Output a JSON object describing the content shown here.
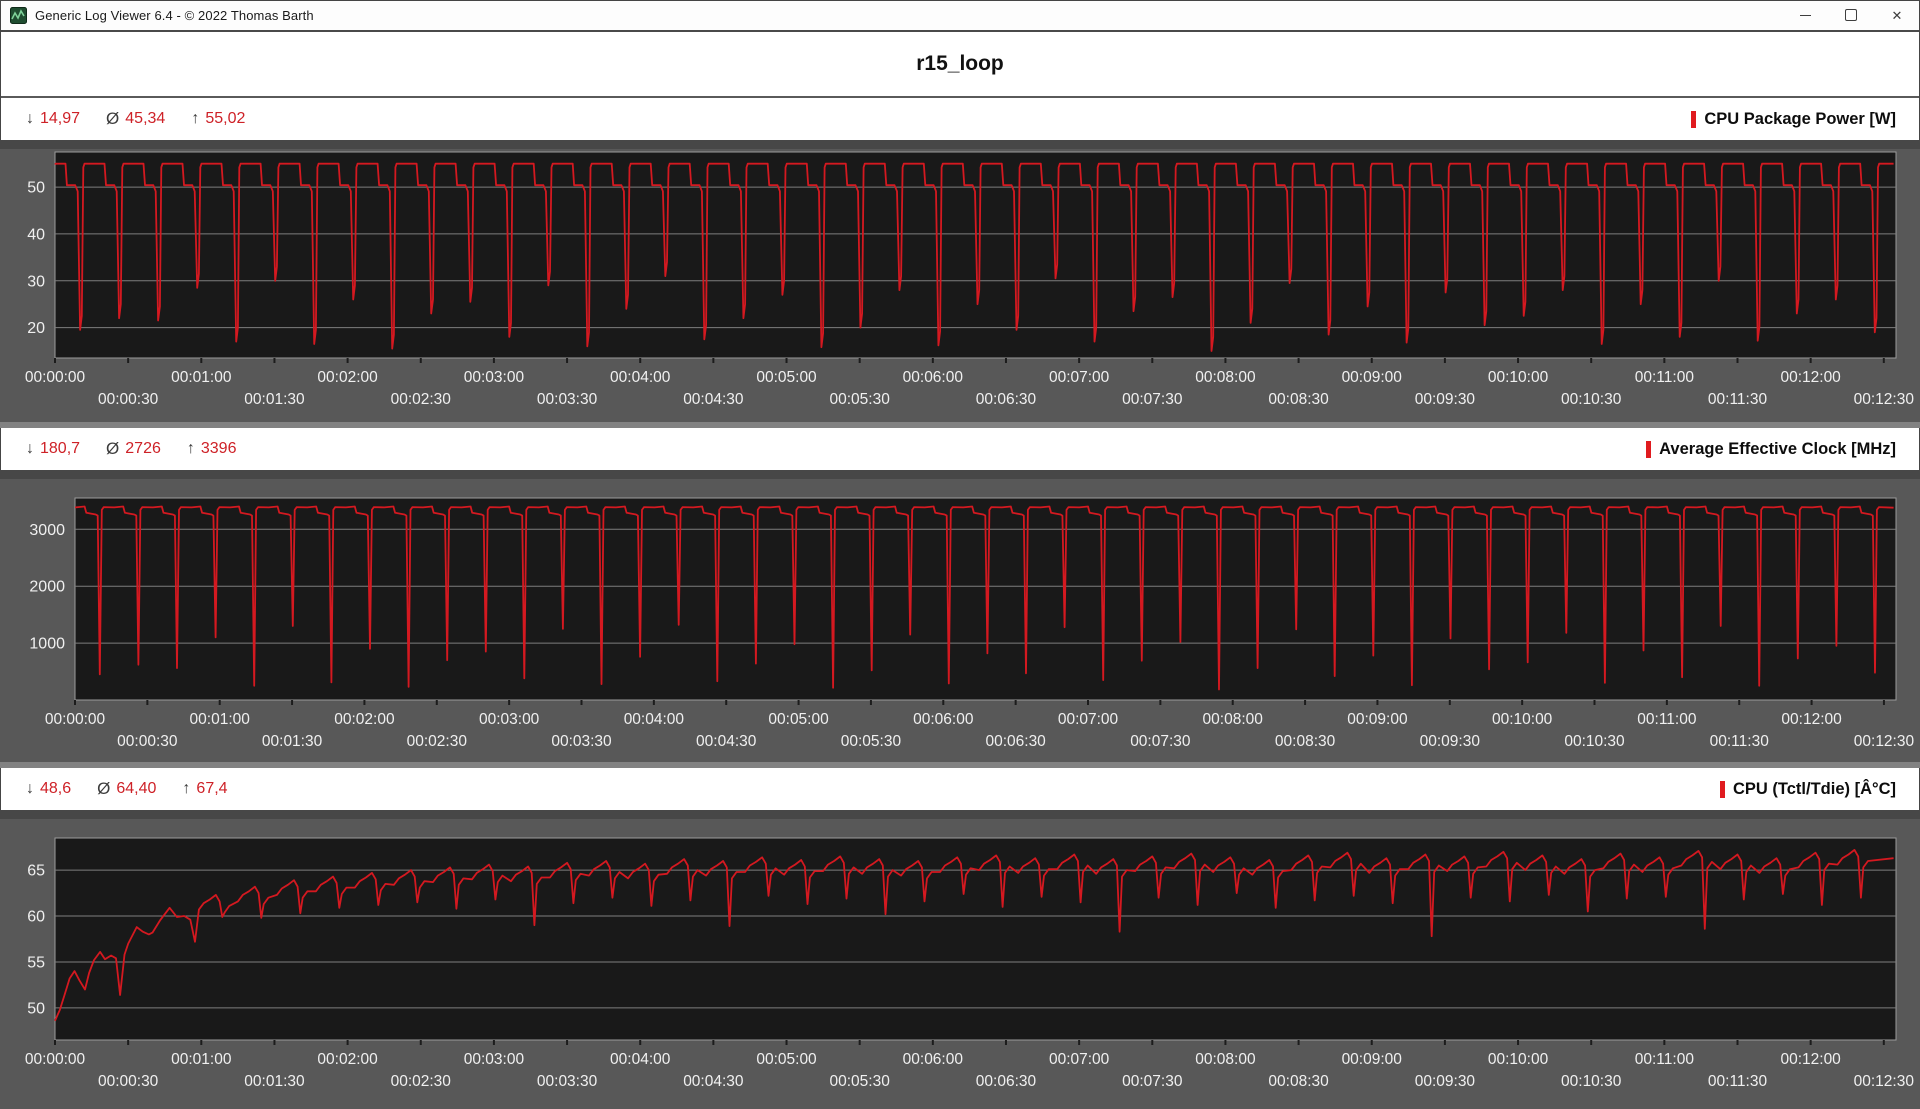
{
  "window": {
    "title": "Generic Log Viewer 6.4 - © 2022 Thomas Barth",
    "controls": {
      "minimize": "minimize",
      "maximize": "maximize",
      "close": "close"
    }
  },
  "header": {
    "title": "r15_loop"
  },
  "stat_symbols": {
    "min": "↓",
    "avg": "Ø",
    "max": "↑"
  },
  "colors": {
    "series_red": "#d41920",
    "accent_bar_red": "#e01b1f",
    "plot_background": "#191919",
    "zone_background": "#585858",
    "gridline": "#7e7e7e",
    "axis_text": "#f0f0f0",
    "stat_value_red": "#ce2127"
  },
  "chart_data": [
    {
      "type": "line",
      "title": "CPU Package Power [W]",
      "stats": {
        "min": "14,97",
        "avg": "45,34",
        "max": "55,02"
      },
      "line_color": "#d41920",
      "y_ticks": [
        20,
        30,
        40,
        50
      ],
      "y_range": [
        13.5,
        57.5
      ],
      "x_range_s": [
        0,
        755
      ],
      "x_tick_step_s": 30,
      "y_gridlines": true,
      "legend": false,
      "x_labels_row1": [
        "00:00:00",
        "00:01:00",
        "00:02:00",
        "00:03:00",
        "00:04:00",
        "00:05:00",
        "00:06:00",
        "00:07:00",
        "00:08:00",
        "00:09:00",
        "00:10:00",
        "00:11:00",
        "00:12:00"
      ],
      "x_labels_row2": [
        "00:00:30",
        "00:01:30",
        "00:02:30",
        "00:03:30",
        "00:04:30",
        "00:05:30",
        "00:06:30",
        "00:07:30",
        "00:08:30",
        "00:09:30",
        "00:10:30",
        "00:11:30",
        "00:12:30"
      ],
      "series": {
        "lead_in": [
          [
            0,
            54.8
          ]
        ],
        "start_s": 0,
        "cycles": 47,
        "period_s": 16,
        "template": [
          [
            0.3,
            "P"
          ],
          [
            4.3,
            "P"
          ],
          [
            4.9,
            "S"
          ],
          [
            8.3,
            "S"
          ],
          [
            9.3,
            "S-1.3"
          ],
          [
            10.3,
            "D"
          ],
          [
            11.0,
            "D+3"
          ],
          [
            11.6,
            "P-0.8"
          ],
          [
            12.1,
            "P"
          ]
        ],
        "levels": {
          "P": 55.0,
          "S": 50.4,
          "D": [
            19.5,
            22,
            21.5,
            28.5,
            17,
            30,
            16.5,
            26,
            15.5,
            23,
            25.5,
            18,
            29,
            16,
            24,
            31,
            17.5,
            22,
            27,
            15.8,
            20,
            28,
            16.2,
            25,
            19.5,
            30.5,
            17,
            23.5,
            26.5,
            15,
            21,
            29.5,
            18.5,
            24.5,
            16.8,
            27.5,
            20.5,
            22.5,
            28,
            16.5,
            25,
            18,
            30,
            17.2,
            23,
            26,
            19
          ]
        },
        "lead_out": [
          [
            754,
            55
          ]
        ]
      }
    },
    {
      "type": "line",
      "title": "Average Effective Clock [MHz]",
      "stats": {
        "min": "180,7",
        "avg": "2726",
        "max": "3396"
      },
      "line_color": "#d41920",
      "y_ticks": [
        1000,
        2000,
        3000
      ],
      "y_range": [
        0,
        3550
      ],
      "x_range_s": [
        0,
        755
      ],
      "x_tick_step_s": 30,
      "y_gridlines": true,
      "legend": false,
      "x_labels_row1": [
        "00:00:00",
        "00:01:00",
        "00:02:00",
        "00:03:00",
        "00:04:00",
        "00:05:00",
        "00:06:00",
        "00:07:00",
        "00:08:00",
        "00:09:00",
        "00:10:00",
        "00:11:00",
        "00:12:00"
      ],
      "x_labels_row2": [
        "00:00:30",
        "00:01:30",
        "00:02:30",
        "00:03:30",
        "00:04:30",
        "00:05:30",
        "00:06:30",
        "00:07:30",
        "00:08:30",
        "00:09:30",
        "00:10:30",
        "00:11:30",
        "00:12:30"
      ],
      "series": {
        "lead_in": [
          [
            0,
            3385
          ]
        ],
        "start_s": 0,
        "cycles": 47,
        "period_s": 16,
        "template": [
          [
            0.3,
            "P-15"
          ],
          [
            4.0,
            "P"
          ],
          [
            4.7,
            "S"
          ],
          [
            8.6,
            "S-30"
          ],
          [
            9.4,
            "S-50"
          ],
          [
            10.3,
            "D"
          ],
          [
            11.1,
            "P-60"
          ],
          [
            11.9,
            "P-10"
          ]
        ],
        "levels": {
          "P": 3400,
          "S": 3290,
          "D": [
            450,
            620,
            560,
            1100,
            250,
            1300,
            310,
            900,
            230,
            700,
            850,
            380,
            1250,
            280,
            760,
            1320,
            330,
            640,
            980,
            215,
            520,
            1150,
            290,
            820,
            470,
            1280,
            350,
            690,
            1020,
            185,
            560,
            1240,
            420,
            780,
            260,
            1080,
            540,
            660,
            1180,
            300,
            870,
            400,
            1300,
            250,
            730,
            950,
            480
          ]
        },
        "lead_out": [
          [
            754,
            3380
          ]
        ]
      }
    },
    {
      "type": "line",
      "title": "CPU (Tctl/Tdie) [Â°C]",
      "stats": {
        "min": "48,6",
        "avg": "64,40",
        "max": "67,4"
      },
      "line_color": "#d41920",
      "y_ticks": [
        50,
        55,
        60,
        65
      ],
      "y_range": [
        46.5,
        68.5
      ],
      "x_range_s": [
        0,
        755
      ],
      "x_tick_step_s": 30,
      "y_gridlines": true,
      "legend": false,
      "x_labels_row1": [
        "00:00:00",
        "00:01:00",
        "00:02:00",
        "00:03:00",
        "00:04:00",
        "00:05:00",
        "00:06:00",
        "00:07:00",
        "00:08:00",
        "00:09:00",
        "00:10:00",
        "00:11:00",
        "00:12:00"
      ],
      "x_labels_row2": [
        "00:00:30",
        "00:01:30",
        "00:02:30",
        "00:03:30",
        "00:04:30",
        "00:05:30",
        "00:06:30",
        "00:07:30",
        "00:08:30",
        "00:09:30",
        "00:10:30",
        "00:11:30",
        "00:12:30"
      ],
      "series": {
        "lead_in": [
          [
            0,
            48.6
          ],
          [
            2,
            49.8
          ],
          [
            4,
            51.5
          ],
          [
            6,
            53.2
          ],
          [
            8,
            54.0
          ],
          [
            10,
            53.0
          ],
          [
            12.3,
            52.0
          ],
          [
            14,
            53.8
          ],
          [
            16,
            55.2
          ],
          [
            18.5,
            56.1
          ],
          [
            20.5,
            55.3
          ],
          [
            23,
            55.7
          ],
          [
            25,
            55.4
          ],
          [
            26.7,
            51.4
          ],
          [
            28.5,
            55.8
          ],
          [
            30,
            57.0
          ],
          [
            33.5,
            58.8
          ],
          [
            36,
            58.3
          ],
          [
            38.5,
            58.0
          ],
          [
            40,
            58.2
          ],
          [
            43,
            59.5
          ],
          [
            47,
            60.9
          ],
          [
            50,
            59.9
          ],
          [
            53,
            60.0
          ],
          [
            55.5,
            59.6
          ],
          [
            57.4,
            57.2
          ]
        ],
        "start_s": 58,
        "cycles": 43,
        "period_s": 16,
        "template": [
          [
            1,
            "P-1.6"
          ],
          [
            3,
            "P-0.9"
          ],
          [
            5.5,
            "P-0.5"
          ],
          [
            8,
            "P"
          ],
          [
            9.5,
            "P-0.7"
          ],
          [
            10.6,
            "D"
          ],
          [
            11.6,
            "P-1.9"
          ],
          [
            13.5,
            "P-1.2"
          ]
        ],
        "levels": {
          "P": [
            62.3,
            63.2,
            63.9,
            64.3,
            64.7,
            65.0,
            65.3,
            65.6,
            65.4,
            65.8,
            66.0,
            65.7,
            66.2,
            66.0,
            66.4,
            66.1,
            66.5,
            66.2,
            66.0,
            66.4,
            66.6,
            66.3,
            66.7,
            66.2,
            66.5,
            66.8,
            66.4,
            66.1,
            66.6,
            66.9,
            66.3,
            66.7,
            66.5,
            67.0,
            66.6,
            66.2,
            66.8,
            66.4,
            67.1,
            66.7,
            66.3,
            66.9,
            67.2
          ],
          "D": [
            59.9,
            59.8,
            60.3,
            60.9,
            61.2,
            61.5,
            60.8,
            61.8,
            59.0,
            61.4,
            62.0,
            61.1,
            61.7,
            58.9,
            62.2,
            61.3,
            61.9,
            60.2,
            61.6,
            62.4,
            61.0,
            62.1,
            61.5,
            58.3,
            62.0,
            61.2,
            62.5,
            60.9,
            61.7,
            62.2,
            61.4,
            57.8,
            62.0,
            61.6,
            62.3,
            60.5,
            61.9,
            62.1,
            58.6,
            61.8,
            62.4,
            61.2,
            62.0
          ]
        },
        "lead_out": [
          [
            754,
            66.3
          ]
        ]
      }
    }
  ]
}
